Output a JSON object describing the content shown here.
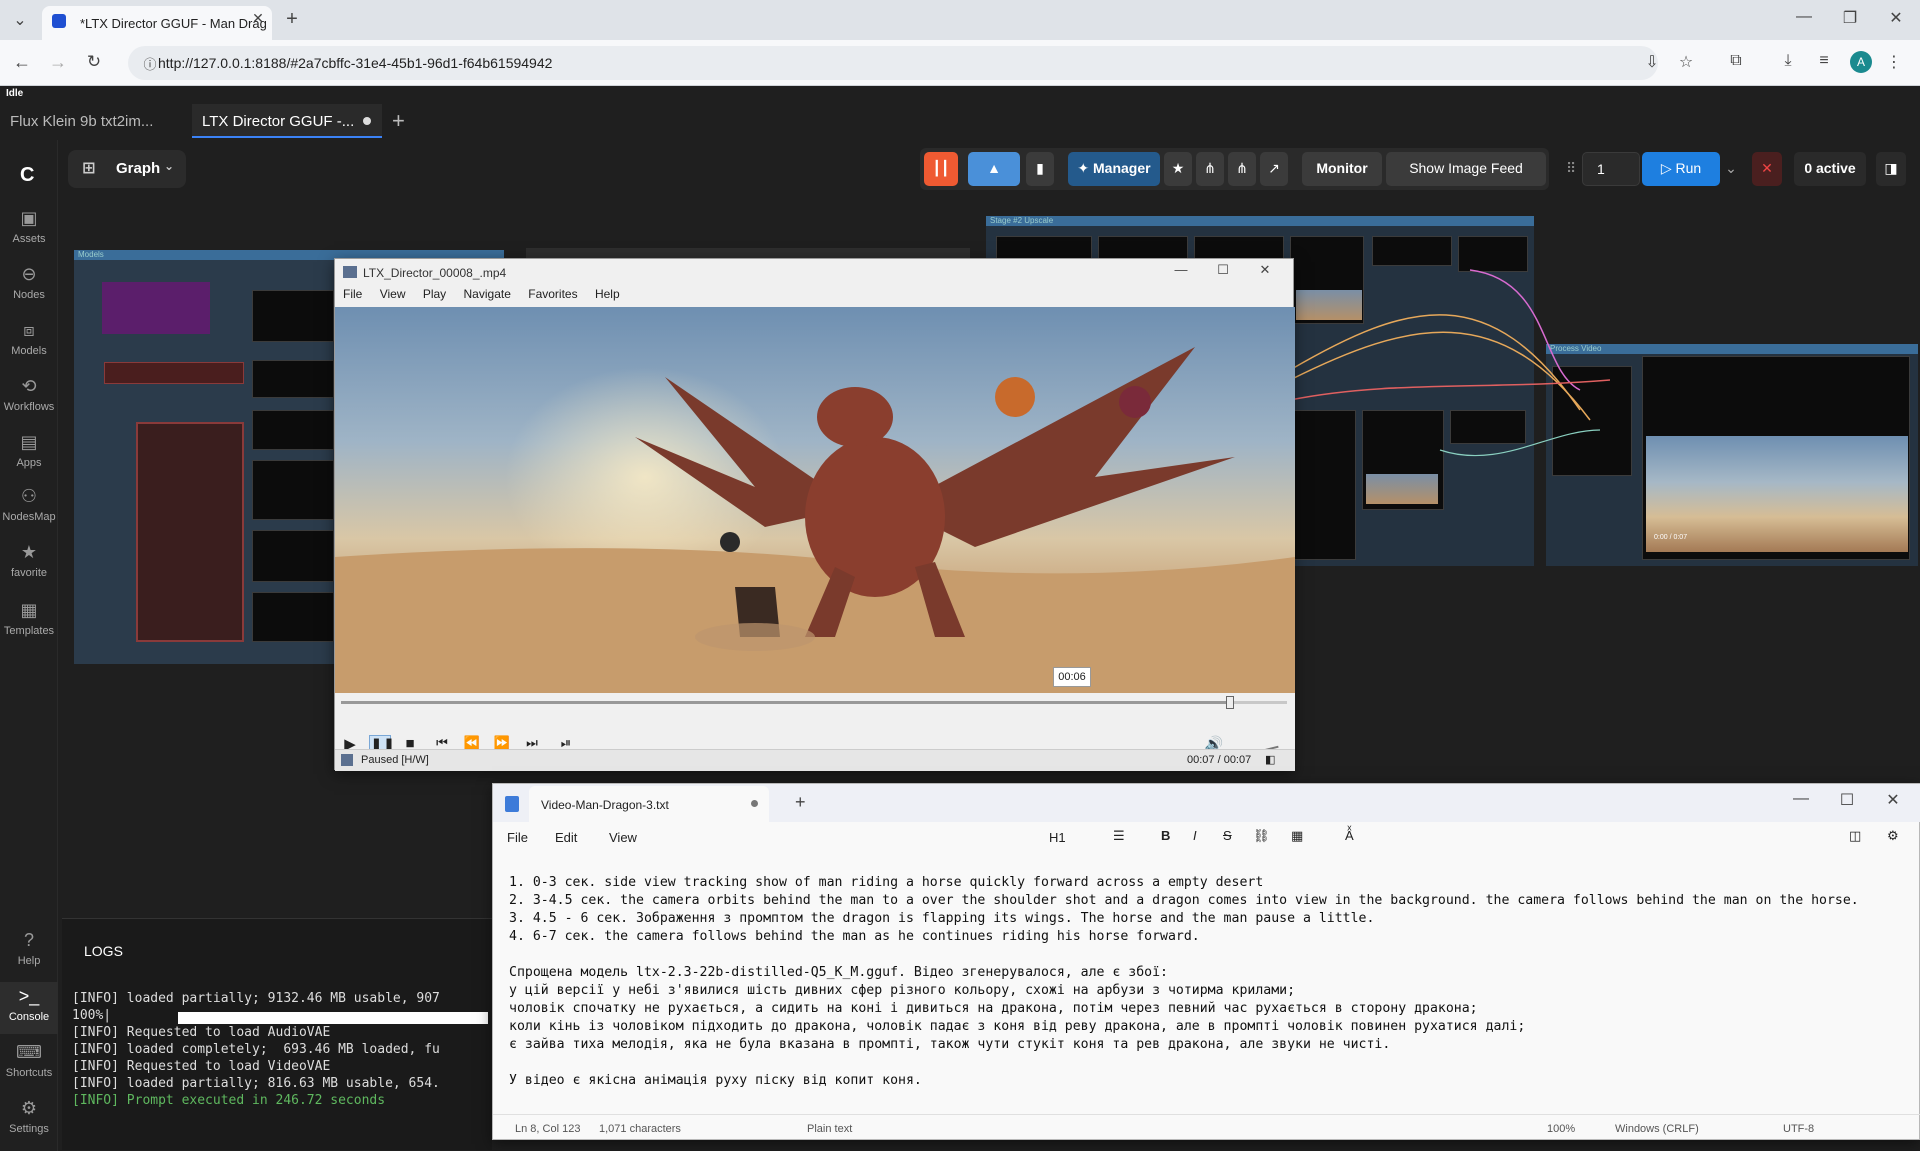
{
  "browser": {
    "tab_title": "*LTX Director GGUF - Man Drag",
    "url": "http://127.0.0.1:8188/#2a7cbffc-31e4-45b1-96d1-f64b61594942",
    "profile_initial": "A"
  },
  "app": {
    "status": "Idle",
    "workflow_tabs": [
      "Flux Klein 9b txt2im...",
      "LTX Director GGUF -..."
    ],
    "sidebar": [
      {
        "label": "Assets",
        "icon": "image-icon"
      },
      {
        "label": "Nodes",
        "icon": "nodes-icon"
      },
      {
        "label": "Models",
        "icon": "cube-icon"
      },
      {
        "label": "Workflows",
        "icon": "flow-icon"
      },
      {
        "label": "Apps",
        "icon": "apps-icon"
      },
      {
        "label": "NodesMap",
        "icon": "map-icon"
      },
      {
        "label": "favorite",
        "icon": "star-icon"
      },
      {
        "label": "Templates",
        "icon": "templates-icon"
      },
      {
        "label": "Help",
        "icon": "help-icon"
      },
      {
        "label": "Console",
        "icon": "console-icon"
      },
      {
        "label": "Shortcuts",
        "icon": "keyboard-icon"
      },
      {
        "label": "Settings",
        "icon": "gear-icon"
      }
    ],
    "graph_label": "Graph",
    "toolbar": {
      "manager": "Manager",
      "monitor": "Monitor",
      "show_image_feed": "Show Image Feed",
      "queue_count": "1",
      "run": "Run",
      "active": "0 active"
    },
    "groups": {
      "models": "Models",
      "upscale": "Stage #2 Upscale",
      "process": "Process Video"
    },
    "preview_time": "0:00 / 0:07"
  },
  "player": {
    "title": "LTX_Director_00008_.mp4",
    "menu": [
      "File",
      "View",
      "Play",
      "Navigate",
      "Favorites",
      "Help"
    ],
    "tooltip": "00:06",
    "progress": 0.94,
    "status": "Paused [H/W]",
    "time": "00:07 / 00:07"
  },
  "notepad": {
    "tab": "Video-Man-Dragon-3.txt",
    "menu": [
      "File",
      "Edit",
      "View"
    ],
    "heading": "H1",
    "lines": [
      "1. 0-3 сек. side view tracking show of man riding a horse quickly forward across a empty desert",
      "2. 3-4.5 сек. the camera orbits behind the man to a over the shoulder shot and a dragon comes into view in the background. the camera follows behind the man on the horse.",
      "3. 4.5 - 6 сек. Зображення з промптом the dragon is flapping its wings. The horse and the man pause a little.",
      "4. 6-7 сек. the camera follows behind the man as he continues riding his horse forward.",
      "",
      "Спрощена модель ltx-2.3-22b-distilled-Q5_K_M.gguf. Відео згенерувалося, але є збої:",
      "у цій версії у небі з'явилися шість дивних сфер різного кольору, схожі на арбузи з чотирма крилами;",
      "чоловік спочатку не рухається, а сидить на коні і дивиться на дракона, потім через певний час рухається в сторону дракона;",
      "коли кінь із чоловіком підходить до дракона, чоловік падає з коня від реву дракона, але в промпті чоловік повинен рухатися далі;",
      "є зайва тиха мелодія, яка не була вказана в промпті, також чути стукіт коня та рев дракона, але звуки не чисті.",
      "",
      "У відео є якісна анімація руху піску від копит коня."
    ],
    "status": {
      "position": "Ln 8, Col 123",
      "chars": "1,071 characters",
      "format": "Plain text",
      "zoom": "100%",
      "eol": "Windows (CRLF)",
      "encoding": "UTF-8"
    }
  },
  "logs": {
    "title": "LOGS",
    "lines": [
      {
        "t": "[INFO] loaded partially; 9132.46 MB usable, 907",
        "ok": false
      },
      {
        "t": "100%|",
        "ok": false
      },
      {
        "t": "[INFO] Requested to load AudioVAE",
        "ok": false
      },
      {
        "t": "[INFO] loaded completely;  693.46 MB loaded, fu",
        "ok": false
      },
      {
        "t": "[INFO] Requested to load VideoVAE",
        "ok": false
      },
      {
        "t": "[INFO] loaded partially; 816.63 MB usable, 654.",
        "ok": false
      },
      {
        "t": "[INFO] Prompt executed in 246.72 seconds",
        "ok": true
      }
    ]
  }
}
